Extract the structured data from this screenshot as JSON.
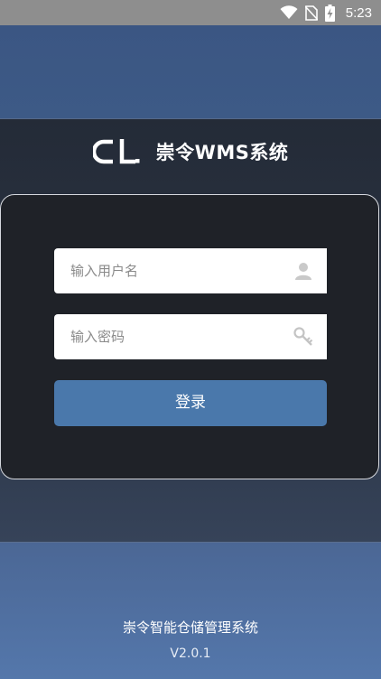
{
  "status_bar": {
    "time": "5:23",
    "icons": [
      "wifi-icon",
      "no-sim-icon",
      "battery-charging-icon"
    ]
  },
  "brand": {
    "logo_text": "CL",
    "title": "崇令WMS系统"
  },
  "login_form": {
    "username": {
      "placeholder": "输入用户名",
      "value": "",
      "icon": "user-icon"
    },
    "password": {
      "placeholder": "输入密码",
      "value": "",
      "icon": "key-icon"
    },
    "submit_label": "登录"
  },
  "footer": {
    "system_name": "崇令智能仓储管理系统",
    "version": "V2.0.1"
  },
  "colors": {
    "status_bar": "#8e8e8e",
    "top_band": "#3d5a86",
    "card_bg": "#1f2228",
    "button": "#4a78ab",
    "bottom_band": "#5477ab"
  }
}
